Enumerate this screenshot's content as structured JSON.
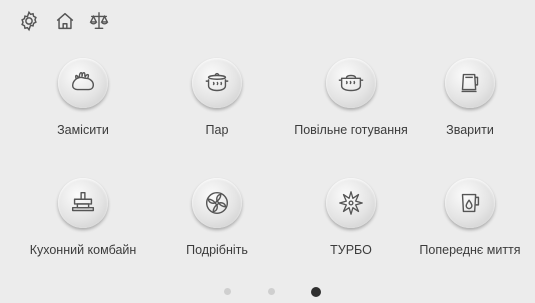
{
  "topbar": {
    "icons": [
      "settings-gear-icon",
      "home-icon",
      "scale-icon"
    ]
  },
  "programs": [
    {
      "label": "Замісити",
      "icon": "kneading-dough-icon"
    },
    {
      "label": "Пар",
      "icon": "steam-pot-icon"
    },
    {
      "label": "Повільне готування",
      "icon": "slow-cook-pot-icon"
    },
    {
      "label": "Зварити",
      "icon": "kettle-icon"
    },
    {
      "label": "Кухонний комбайн",
      "icon": "food-processor-icon"
    },
    {
      "label": "Подрібніть",
      "icon": "chop-blade-icon"
    },
    {
      "label": "ТУРБО",
      "icon": "turbo-star-icon"
    },
    {
      "label": "Попереднє миття",
      "icon": "prewash-jug-icon"
    }
  ],
  "pager": {
    "pages": 3,
    "active_index": 2
  },
  "colors": {
    "background": "#ececec",
    "icon_stroke": "#555555",
    "dot_active": "#2f2f2f",
    "dot_inactive": "#cfcfcf"
  }
}
